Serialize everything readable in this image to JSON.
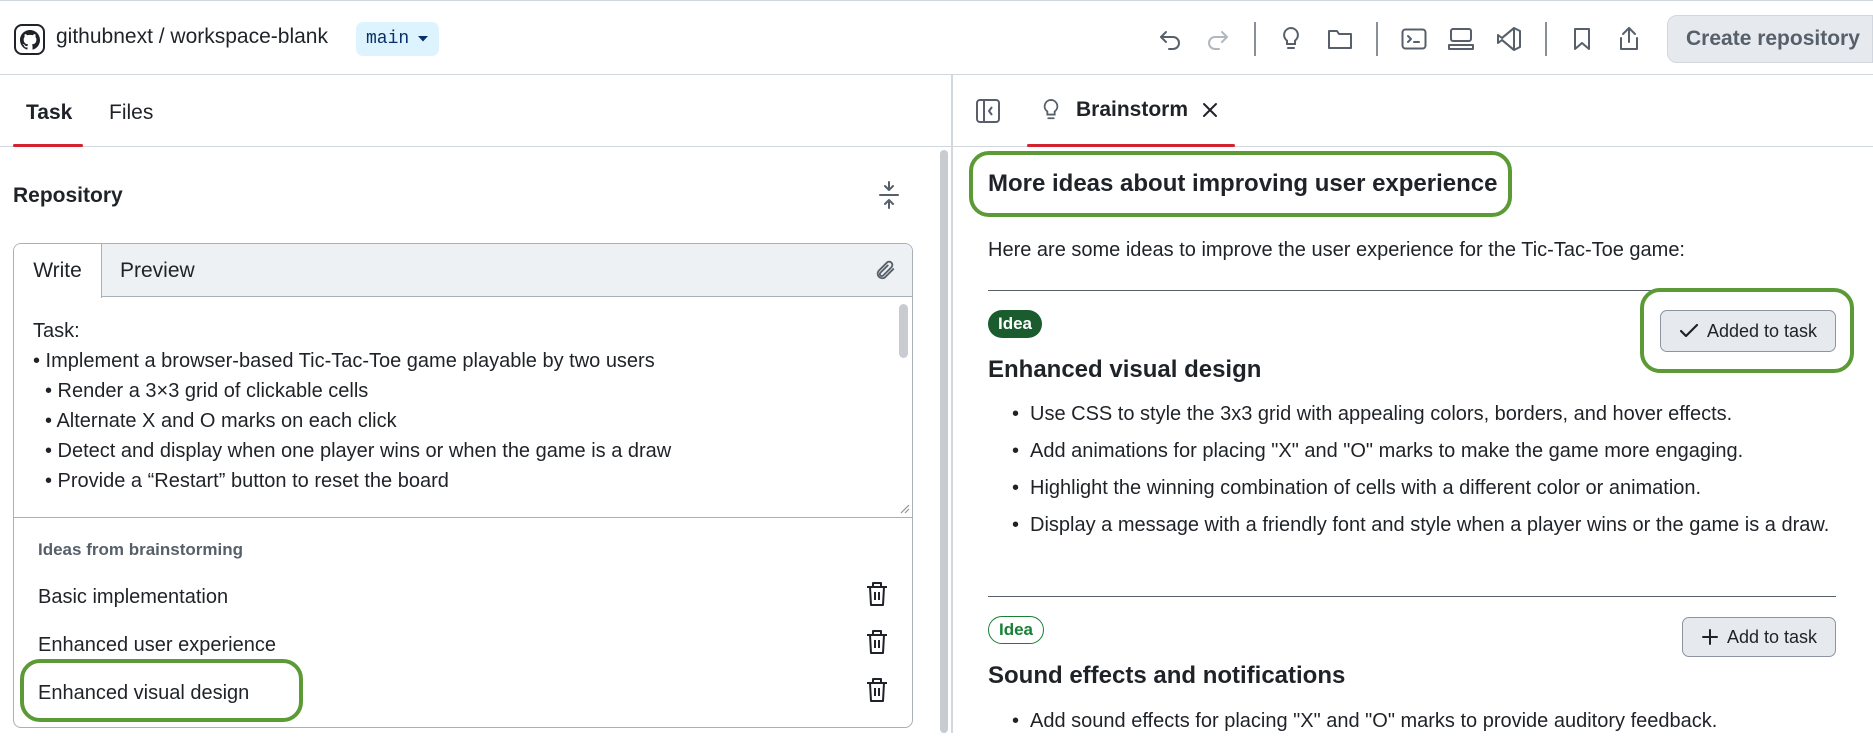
{
  "header": {
    "repo_path": "githubnext / workspace-blank",
    "branch": "main",
    "create_button": "Create repository"
  },
  "left": {
    "tabs": [
      "Task",
      "Files"
    ],
    "section_title": "Repository",
    "editor": {
      "tab_write": "Write",
      "tab_preview": "Preview",
      "lines": [
        "Task:",
        "• Implement a browser-based Tic-Tac-Toe game playable by two users",
        "• Render a 3×3 grid of clickable cells",
        "• Alternate X and O marks on each click",
        "• Detect and display when one player wins or when the game is a draw",
        "• Provide a “Restart” button to reset the board"
      ]
    },
    "ideas_heading": "Ideas from brainstorming",
    "ideas": [
      "Basic implementation",
      "Enhanced user experience",
      "Enhanced visual design"
    ]
  },
  "right": {
    "tab_label": "Brainstorm",
    "title": "More ideas about improving user experience",
    "intro": "Here are some ideas to improve the user experience for the Tic-Tac-Toe game:",
    "ideas": [
      {
        "badge": "Idea",
        "title": "Enhanced visual design",
        "action": "Added to task",
        "bullets": [
          "Use CSS to style the 3x3 grid with appealing colors, borders, and hover effects.",
          "Add animations for placing \"X\" and \"O\" marks to make the game more engaging.",
          "Highlight the winning combination of cells with a different color or animation.",
          "Display a message with a friendly font and style when a player wins or the game is a draw."
        ]
      },
      {
        "badge": "Idea",
        "title": "Sound effects and notifications",
        "action": "Add to task",
        "bullets": [
          "Add sound effects for placing \"X\" and \"O\" marks to provide auditory feedback."
        ]
      }
    ]
  },
  "colors": {
    "accent_red": "#d1242f",
    "highlight_green": "#5c9a35",
    "badge_green": "#1a5c2e",
    "branch_bg": "#ddf4ff"
  },
  "icons": [
    "github-icon",
    "caret-down-icon",
    "undo-icon",
    "redo-icon",
    "lightbulb-icon",
    "folder-icon",
    "terminal-icon",
    "server-icon",
    "vscode-icon",
    "bookmark-icon",
    "share-icon",
    "collapse-icon",
    "paperclip-icon",
    "trash-icon",
    "sidebar-toggle-icon",
    "close-icon",
    "check-icon",
    "plus-icon"
  ]
}
